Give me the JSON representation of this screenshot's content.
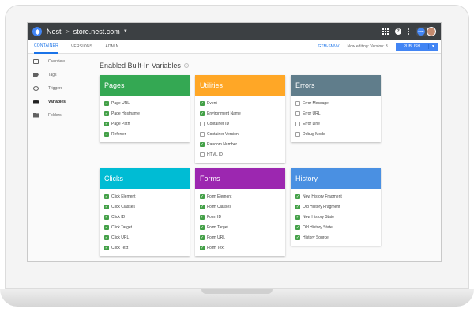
{
  "topbar": {
    "account": "Nest",
    "separator": ">",
    "container": "store.nest.com",
    "badge": "GWG"
  },
  "tabs": [
    {
      "label": "CONTAINER",
      "active": true
    },
    {
      "label": "VERSIONS",
      "active": false
    },
    {
      "label": "ADMIN",
      "active": false
    }
  ],
  "subbar": {
    "container_id": "GTM-SMVV",
    "now_editing": "Now editing: Version: 3",
    "publish": "PUBLISH"
  },
  "sidebar": {
    "items": [
      {
        "label": "Overview",
        "icon": "overview-icon",
        "active": false
      },
      {
        "label": "Tags",
        "icon": "tag-icon",
        "active": false
      },
      {
        "label": "Triggers",
        "icon": "trigger-icon",
        "active": false
      },
      {
        "label": "Variables",
        "icon": "variables-icon",
        "active": true
      },
      {
        "label": "Folders",
        "icon": "folder-icon",
        "active": false
      }
    ]
  },
  "main": {
    "title": "Enabled Built-In Variables"
  },
  "cards": [
    {
      "title": "Pages",
      "color": "#34a853",
      "items": [
        {
          "label": "Page URL",
          "checked": true
        },
        {
          "label": "Page Hostname",
          "checked": true
        },
        {
          "label": "Page Path",
          "checked": true
        },
        {
          "label": "Referrer",
          "checked": true
        }
      ]
    },
    {
      "title": "Utilities",
      "color": "#ffa726",
      "items": [
        {
          "label": "Event",
          "checked": true
        },
        {
          "label": "Environment Name",
          "checked": true
        },
        {
          "label": "Container ID",
          "checked": false
        },
        {
          "label": "Container Version",
          "checked": false
        },
        {
          "label": "Random Number",
          "checked": true
        },
        {
          "label": "HTML ID",
          "checked": false
        }
      ]
    },
    {
      "title": "Errors",
      "color": "#607d8b",
      "items": [
        {
          "label": "Error Message",
          "checked": false
        },
        {
          "label": "Error URL",
          "checked": false
        },
        {
          "label": "Error Line",
          "checked": false
        },
        {
          "label": "Debug Mode",
          "checked": false
        }
      ]
    },
    {
      "title": "Clicks",
      "color": "#00bcd4",
      "items": [
        {
          "label": "Click Element",
          "checked": true
        },
        {
          "label": "Click Classes",
          "checked": true
        },
        {
          "label": "Click ID",
          "checked": true
        },
        {
          "label": "Click Target",
          "checked": true
        },
        {
          "label": "Click URL",
          "checked": true
        },
        {
          "label": "Click Text",
          "checked": true
        }
      ]
    },
    {
      "title": "Forms",
      "color": "#9c27b0",
      "items": [
        {
          "label": "Form Element",
          "checked": true
        },
        {
          "label": "Form Classes",
          "checked": true
        },
        {
          "label": "Form ID",
          "checked": true
        },
        {
          "label": "Form Target",
          "checked": true
        },
        {
          "label": "Form URL",
          "checked": true
        },
        {
          "label": "Form Text",
          "checked": true
        }
      ]
    },
    {
      "title": "History",
      "color": "#4a90e2",
      "items": [
        {
          "label": "New History Fragment",
          "checked": true
        },
        {
          "label": "Old History Fragment",
          "checked": true
        },
        {
          "label": "New History State",
          "checked": true
        },
        {
          "label": "Old History State",
          "checked": true
        },
        {
          "label": "History Source",
          "checked": true
        }
      ]
    }
  ]
}
